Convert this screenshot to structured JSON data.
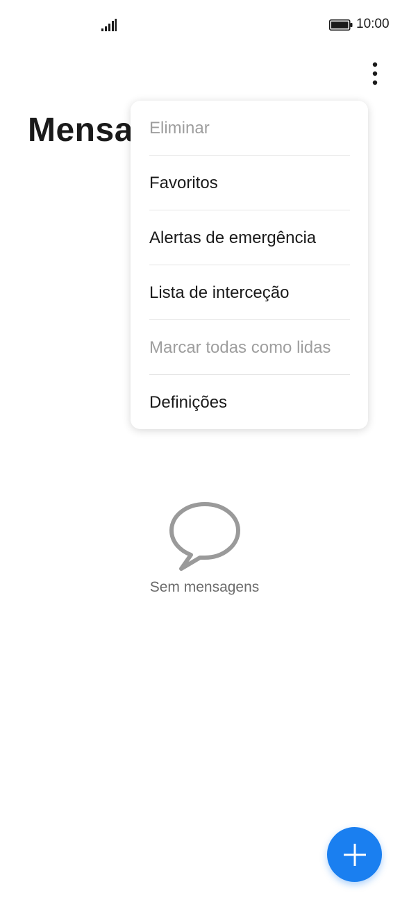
{
  "status_bar": {
    "time": "10:00",
    "signal_icon": "signal-icon",
    "battery_icon": "battery-icon"
  },
  "header": {
    "title": "Mensa",
    "more_icon": "more-vertical-icon"
  },
  "menu": {
    "items": [
      {
        "label": "Eliminar",
        "enabled": false
      },
      {
        "label": "Favoritos",
        "enabled": true
      },
      {
        "label": "Alertas de emergência",
        "enabled": true
      },
      {
        "label": "Lista de interceção",
        "enabled": true
      },
      {
        "label": "Marcar todas como lidas",
        "enabled": false
      },
      {
        "label": "Definições",
        "enabled": true
      }
    ]
  },
  "empty_state": {
    "icon": "chat-bubble-icon",
    "text": "Sem mensagens"
  },
  "fab": {
    "icon": "plus-icon",
    "color": "#1a7ff0"
  }
}
